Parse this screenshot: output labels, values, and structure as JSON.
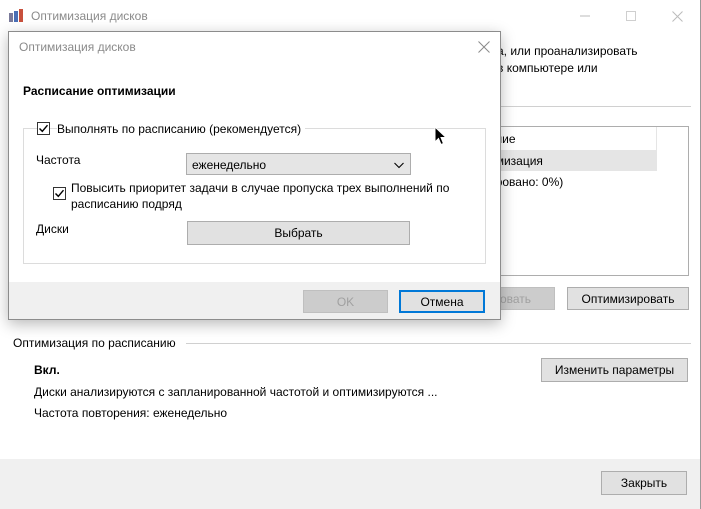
{
  "main_window": {
    "title": "Оптимизация дисков",
    "intro_line1": "а, или проанализировать",
    "intro_line2": "в компьютере или",
    "drive_list": {
      "header": "яние",
      "selected_row": "имизация",
      "row2": "ировано: 0%)"
    },
    "analyze_button": "овать",
    "optimize_button": "Оптимизировать",
    "schedule": {
      "section_title": "Оптимизация по расписанию",
      "status": "Вкл.",
      "description": "Диски анализируются с запланированной частотой и оптимизируются ...",
      "frequency_text": "Частота повторения: еженедельно",
      "change_button": "Изменить параметры"
    },
    "close_button": "Закрыть"
  },
  "dialog": {
    "title": "Оптимизация дисков",
    "heading": "Расписание оптимизации",
    "run_on_schedule": {
      "label": "Выполнять по расписанию (рекомендуется)",
      "checked": true
    },
    "frequency_label": "Частота",
    "frequency_value": "еженедельно",
    "priority": {
      "label_line1": "Повысить приоритет задачи в случае пропуска трех выполнений по",
      "label_line2": "расписанию подряд",
      "checked": true
    },
    "drives_label": "Диски",
    "choose_button": "Выбрать",
    "ok_button": "OK",
    "cancel_button": "Отмена"
  },
  "colors": {
    "accent": "#0078d7",
    "button_face": "#e1e1e1",
    "footer_bg": "#f0f0f0",
    "title_text": "#8a8a8a"
  },
  "icons": {
    "app": "defrag-app-icon",
    "minimize": "minimize-icon",
    "maximize": "maximize-icon",
    "close": "close-icon",
    "checkmark": "checkmark-icon",
    "dropdown": "chevron-down-icon",
    "cursor": "mouse-cursor-icon"
  }
}
